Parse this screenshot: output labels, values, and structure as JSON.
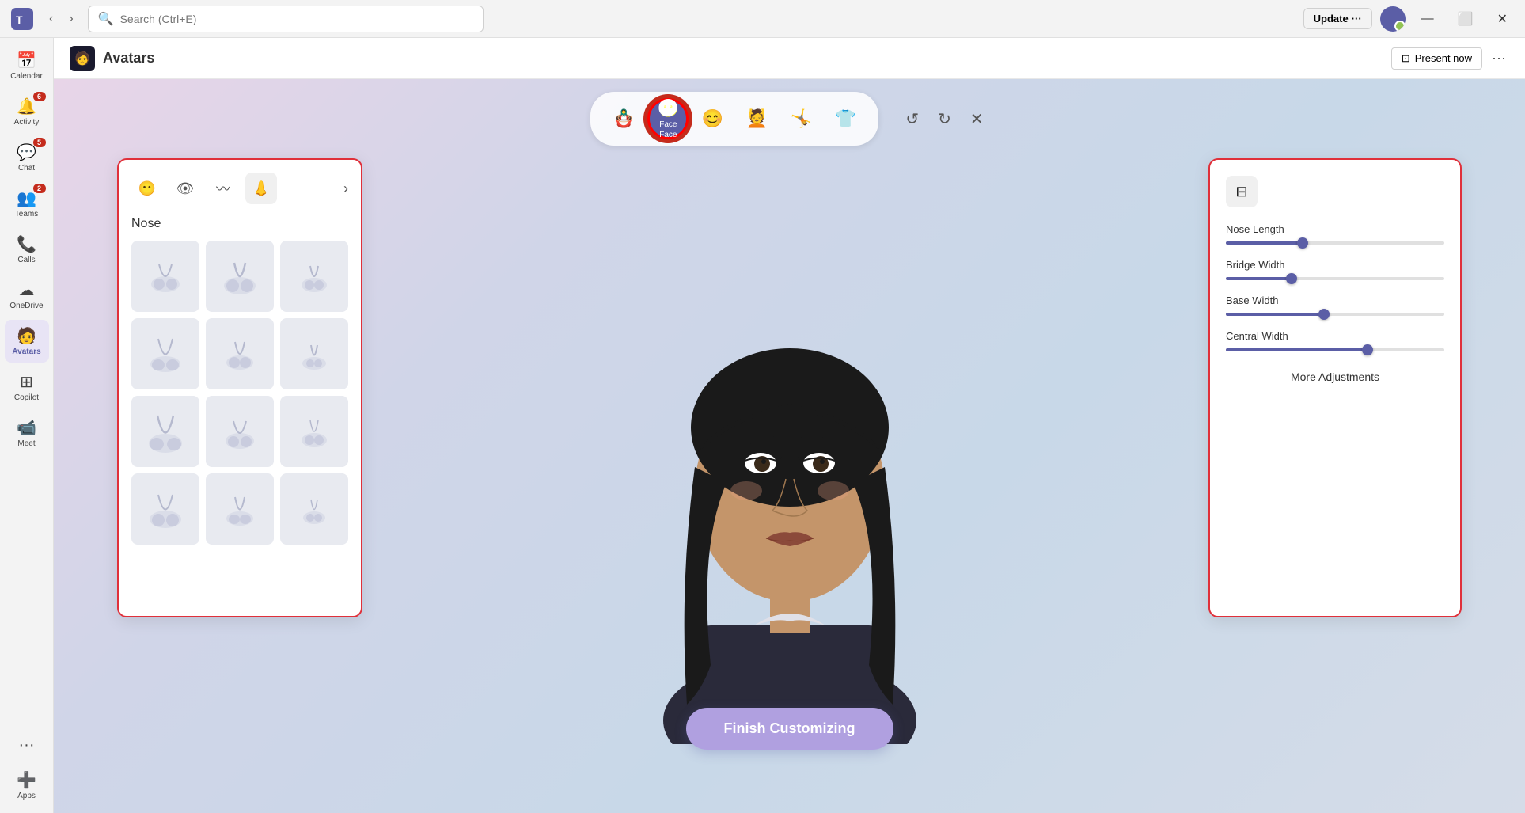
{
  "titlebar": {
    "logo_alt": "Microsoft Teams",
    "search_placeholder": "Search (Ctrl+E)",
    "update_label": "Update",
    "more_dots": "···",
    "minimize_label": "Minimize",
    "maximize_label": "Maximize",
    "close_label": "Close"
  },
  "sidebar": {
    "items": [
      {
        "id": "calendar",
        "label": "Calendar",
        "icon": "📅",
        "badge": null
      },
      {
        "id": "activity",
        "label": "Activity",
        "icon": "🔔",
        "badge": "6"
      },
      {
        "id": "chat",
        "label": "Chat",
        "icon": "💬",
        "badge": "5"
      },
      {
        "id": "teams",
        "label": "Teams",
        "icon": "👥",
        "badge": "2"
      },
      {
        "id": "calls",
        "label": "Calls",
        "icon": "📞",
        "badge": null
      },
      {
        "id": "onedrive",
        "label": "OneDrive",
        "icon": "☁",
        "badge": null
      },
      {
        "id": "avatars",
        "label": "Avatars",
        "icon": "🧑",
        "badge": null,
        "active": true
      },
      {
        "id": "copilot",
        "label": "Copilot",
        "icon": "⊞",
        "badge": null
      },
      {
        "id": "meet",
        "label": "Meet",
        "icon": "📹",
        "badge": null
      },
      {
        "id": "more",
        "label": "···",
        "icon": "···",
        "badge": null
      },
      {
        "id": "apps",
        "label": "Apps",
        "icon": "➕",
        "badge": null
      }
    ]
  },
  "app_header": {
    "icon": "🧑",
    "title": "Avatars",
    "present_now": "Present now",
    "more": "···"
  },
  "toolbar": {
    "tabs": [
      {
        "id": "body",
        "icon": "🪆",
        "label": "",
        "active": false
      },
      {
        "id": "face",
        "icon": "😶",
        "label": "Face",
        "active": true
      },
      {
        "id": "expression",
        "icon": "😊",
        "label": "",
        "active": false
      },
      {
        "id": "hair",
        "icon": "💆",
        "label": "",
        "active": false
      },
      {
        "id": "pose",
        "icon": "🤸",
        "label": "",
        "active": false
      },
      {
        "id": "outfit",
        "icon": "👕",
        "label": "",
        "active": false
      }
    ],
    "undo_label": "Undo",
    "redo_label": "Redo",
    "close_label": "Close"
  },
  "left_panel": {
    "section_title": "Nose",
    "tabs": [
      {
        "id": "face-shape",
        "icon": "😶"
      },
      {
        "id": "eyes",
        "icon": "👁"
      },
      {
        "id": "eyebrows",
        "icon": "〰"
      },
      {
        "id": "nose",
        "icon": "👃",
        "active": true
      },
      {
        "id": "next",
        "icon": "›"
      }
    ],
    "nose_items": [
      1,
      2,
      3,
      4,
      5,
      6,
      7,
      8,
      9,
      10,
      11,
      12
    ]
  },
  "right_panel": {
    "title": "Adjustments",
    "sliders": [
      {
        "id": "nose-length",
        "label": "Nose Length",
        "value": 35,
        "max": 100
      },
      {
        "id": "bridge-width",
        "label": "Bridge Width",
        "value": 30,
        "max": 100
      },
      {
        "id": "base-width",
        "label": "Base Width",
        "value": 45,
        "max": 100
      },
      {
        "id": "central-width",
        "label": "Central Width",
        "value": 65,
        "max": 100
      }
    ],
    "more_adjustments": "More Adjustments"
  },
  "finish_button": {
    "label": "Finish Customizing"
  },
  "colors": {
    "accent": "#5b5ea6",
    "red_border": "#e0303a",
    "badge_red": "#c42b1c",
    "slider_color": "#5b5ea6",
    "active_tab_bg": "#5b5ea6",
    "finish_bg": "#b0a0e0"
  }
}
